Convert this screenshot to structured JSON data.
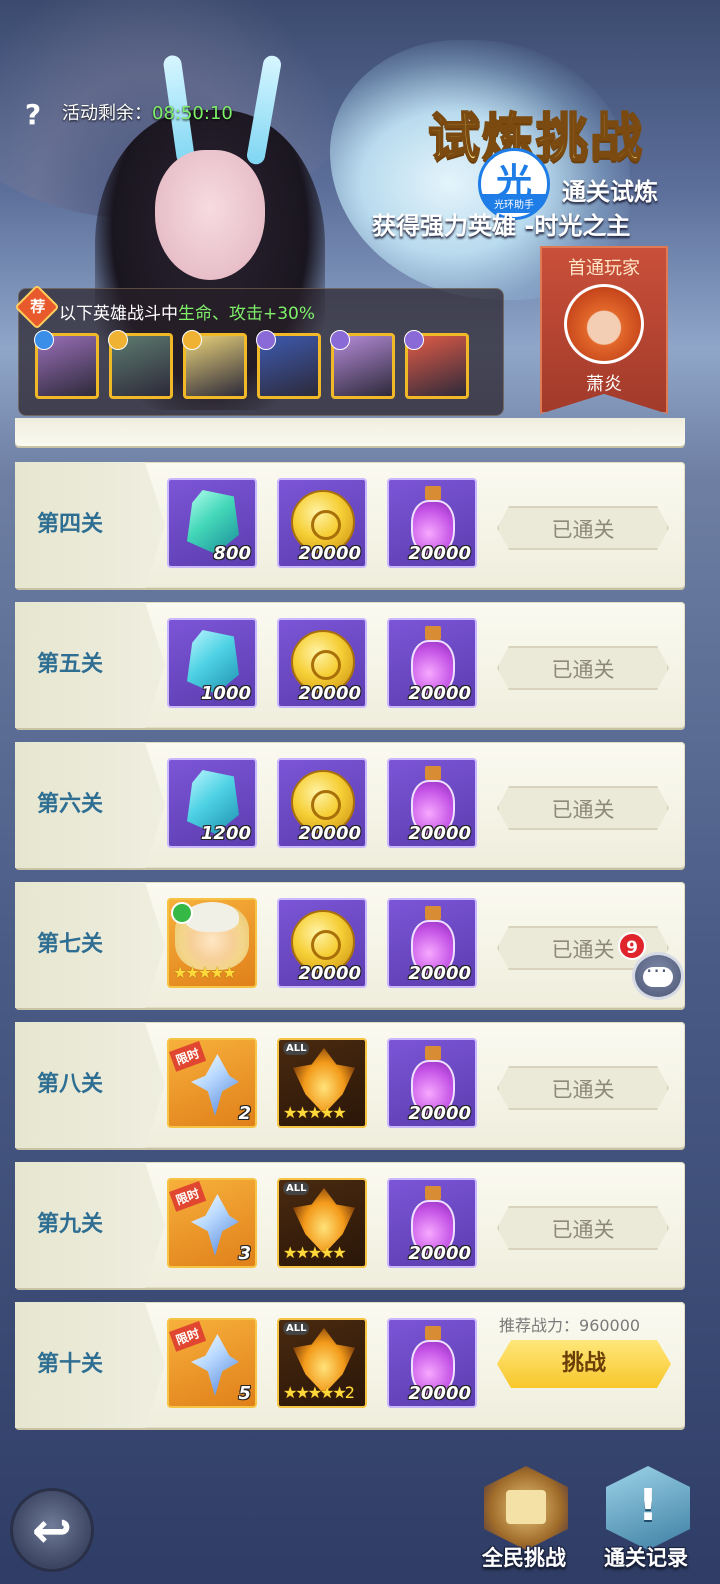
{
  "header": {
    "help_icon": "question-icon",
    "timer_label": "活动剩余：",
    "timer_value": "08:50:10",
    "title": "试炼挑战",
    "watermark_char": "光",
    "watermark_text": "光环助手",
    "subtitle_line1": "通关试炼",
    "subtitle_line2": "获得强力英雄 -时光之主"
  },
  "first_clear": {
    "title": "首通玩家",
    "player_name": "萧炎"
  },
  "bonus": {
    "tag": "荐",
    "text_prefix": "以下英雄战斗中",
    "text_highlight": "生命、攻击+30%",
    "heroes": [
      {
        "name": "hero-1",
        "bg": "#9a6fb8",
        "element_color": "#3a8ee8"
      },
      {
        "name": "hero-2",
        "bg": "#5d7b6f",
        "element_color": "#f0b232"
      },
      {
        "name": "hero-3",
        "bg": "#e9d27a",
        "element_color": "#f0b232"
      },
      {
        "name": "hero-4",
        "bg": "#3d5ab0",
        "element_color": "#8a6ad6"
      },
      {
        "name": "hero-5",
        "bg": "#b58bd8",
        "element_color": "#8a6ad6"
      },
      {
        "name": "hero-6",
        "bg": "#e25b47",
        "element_color": "#8a6ad6"
      }
    ]
  },
  "stages": [
    {
      "label": "第四关",
      "status": "已通关",
      "items": [
        {
          "kind": "gem-green",
          "qty": "800"
        },
        {
          "kind": "coin",
          "qty": "20000"
        },
        {
          "kind": "potion",
          "qty": "20000"
        }
      ]
    },
    {
      "label": "第五关",
      "status": "已通关",
      "items": [
        {
          "kind": "gem",
          "qty": "1000"
        },
        {
          "kind": "coin",
          "qty": "20000"
        },
        {
          "kind": "potion",
          "qty": "20000"
        }
      ]
    },
    {
      "label": "第六关",
      "status": "已通关",
      "items": [
        {
          "kind": "gem",
          "qty": "1200"
        },
        {
          "kind": "coin",
          "qty": "20000"
        },
        {
          "kind": "potion",
          "qty": "20000"
        }
      ]
    },
    {
      "label": "第七关",
      "status": "已通关",
      "items": [
        {
          "kind": "hero-card",
          "qty": "★★★★★"
        },
        {
          "kind": "coin",
          "qty": "20000"
        },
        {
          "kind": "potion",
          "qty": "20000"
        }
      ]
    },
    {
      "label": "第八关",
      "status": "已通关",
      "items": [
        {
          "kind": "shard",
          "qty": "2",
          "tag": "限时"
        },
        {
          "kind": "fire",
          "qty": "★★★★★",
          "tag": "ALL"
        },
        {
          "kind": "potion",
          "qty": "20000"
        }
      ]
    },
    {
      "label": "第九关",
      "status": "已通关",
      "items": [
        {
          "kind": "shard",
          "qty": "3",
          "tag": "限时"
        },
        {
          "kind": "fire",
          "qty": "★★★★★",
          "tag": "ALL"
        },
        {
          "kind": "potion",
          "qty": "20000"
        }
      ]
    },
    {
      "label": "第十关",
      "status": "挑战",
      "recommend_label": "推荐战力：",
      "recommend_value": "960000",
      "items": [
        {
          "kind": "shard",
          "qty": "5",
          "tag": "限时"
        },
        {
          "kind": "fire",
          "qty": "★★★★★2",
          "tag": "ALL"
        },
        {
          "kind": "potion",
          "qty": "20000"
        }
      ]
    }
  ],
  "chat": {
    "icon": "chat-bubble-icon",
    "badge": "9"
  },
  "bottom": {
    "back_icon": "back-arrow-icon",
    "all_label": "全民挑战",
    "record_label": "通关记录",
    "record_icon_char": "!"
  }
}
